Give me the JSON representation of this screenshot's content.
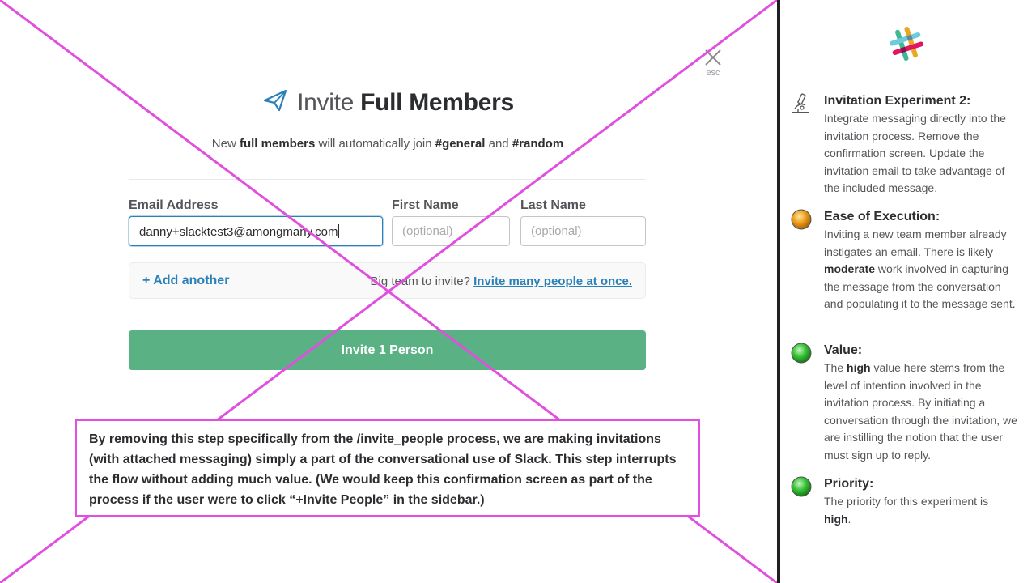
{
  "modal": {
    "close_hint": "esc",
    "title_prefix": "Invite",
    "title_bold": "Full Members",
    "subtitle": {
      "t1": "New ",
      "b1": "full members",
      "t2": " will automatically join ",
      "b2": "#general",
      "t3": " and ",
      "b3": "#random"
    },
    "fields": {
      "email_label": "Email Address",
      "email_value": "danny+slacktest3@amongmany.com",
      "first_label": "First Name",
      "first_placeholder": "(optional)",
      "last_label": "Last Name",
      "last_placeholder": "(optional)"
    },
    "add_another": "+ Add another",
    "big_team_text": "Big team to invite?",
    "big_team_link": "Invite many people at once.",
    "invite_button": "Invite 1 Person"
  },
  "annotation": "By removing this step specifically from the /invite_people process, we are making invitations (with attached messaging) simply a part of the conversational use of Slack. This step interrupts the flow without adding much value. (We would keep this confirmation screen as part of the process if the user were to click “+Invite People” in the sidebar.)",
  "sidebar": {
    "experiment": {
      "title": "Invitation Experiment 2:",
      "body": "Integrate messaging directly into the invitation process. Remove the confirmation screen. Update the invitation email to take advantage of the included message."
    },
    "ease": {
      "title": "Ease of Execution:",
      "b1": "Inviting a new team member already instigates an email. There is likely ",
      "b2": "moderate",
      "b3": " work involved in capturing the message from the conversation and populating it to the message sent.",
      "status_color": "#f0a020"
    },
    "value": {
      "title": "Value:",
      "b1": "The ",
      "b2": "high",
      "b3": " value here stems from the level of intention involved in the invitation process. By initiating a conversation through the invitation, we are instilling the notion that the user must sign up to reply.",
      "status_color": "#3cc43c"
    },
    "priority": {
      "title": "Priority:",
      "b1": "The priority for this experiment is ",
      "b2": "high",
      "b3": ".",
      "status_color": "#3cc43c"
    }
  },
  "colors": {
    "accent_blue": "#2a80b9",
    "button_green": "#5ab183",
    "annotation_magenta": "#e04fe0"
  }
}
